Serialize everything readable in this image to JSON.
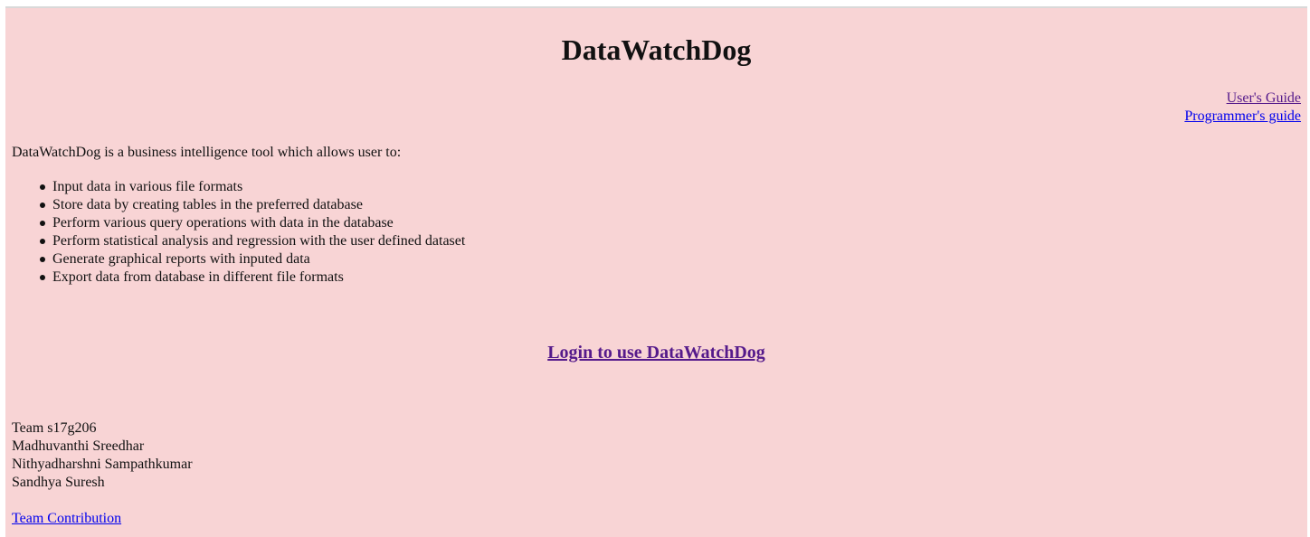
{
  "header": {
    "title": "DataWatchDog"
  },
  "links": {
    "users_guide": "User's Guide",
    "programmers_guide": "Programmer's guide",
    "login": "Login to use DataWatchDog",
    "team_contribution": "Team Contribution"
  },
  "intro": {
    "text": "DataWatchDog is a business intelligence tool which allows user to:"
  },
  "features": [
    "Input data in various file formats",
    "Store data by creating tables in the preferred database",
    "Perform various query operations with data in the database",
    "Perform statistical analysis and regression with the user defined dataset",
    "Generate graphical reports with inputed data",
    "Export data from database in different file formats"
  ],
  "team": {
    "name": "Team s17g206",
    "members": [
      "Madhuvanthi Sreedhar",
      "Nithyadharshni Sampathkumar",
      "Sandhya Suresh"
    ]
  },
  "colors": {
    "background": "#f8d4d5",
    "link_visited": "#551a8b",
    "link_unvisited": "#0000ee"
  }
}
